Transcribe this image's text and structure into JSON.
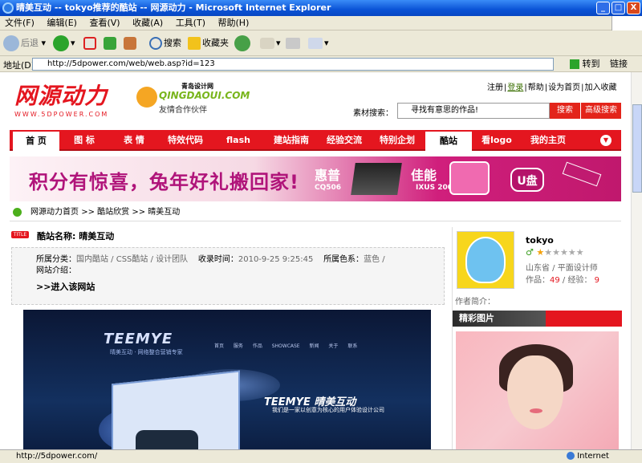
{
  "window": {
    "title": "晴美互动 -- tokyo推荐的酷站 -- 网源动力 - Microsoft Internet Explorer",
    "buttons": [
      "_",
      "□",
      "X"
    ]
  },
  "menubar": [
    "文件(F)",
    "编辑(E)",
    "查看(V)",
    "收藏(A)",
    "工具(T)",
    "帮助(H)"
  ],
  "toolbar": {
    "back": "后退",
    "search": "搜索",
    "favorites": "收藏夹"
  },
  "address": {
    "label": "地址(D)",
    "url": "http://5dpower.com/web/web.asp?id=123",
    "go": "转到",
    "links": "链接"
  },
  "site": {
    "logo_main": "网源动力",
    "logo_sub": "WWW.5DPOWER.COM",
    "partner": {
      "top": "青岛设计网",
      "name": "QINGDAOUI.COM",
      "label": "友情合作伙伴"
    },
    "top_links": [
      "注册",
      "登录",
      "帮助",
      "设为首页",
      "加入收藏"
    ],
    "search": {
      "label": "素材搜索：",
      "placeholder": "寻找有意思的作品!",
      "button": "搜索",
      "advanced": "高级搜索"
    },
    "nav": [
      "首  页",
      "图  标",
      "表  情",
      "特效代码",
      "flash",
      "建站指南",
      "经验交流",
      "特别企划",
      "酷站",
      "看logo",
      "我的主页"
    ],
    "banner": {
      "slogan": "积分有惊喜，兔年好礼搬回家!",
      "brand1": "惠普",
      "brand1_model": "CQ506",
      "brand2": "佳能",
      "brand2_model": "IXUS 200",
      "usb": "U盘"
    },
    "breadcrumb": [
      "网源动力首页",
      ">>",
      "酷站欣赏",
      ">>",
      "晴美互动"
    ]
  },
  "detail": {
    "name_label": "酷站名称:",
    "name": "晴美互动",
    "category_label": "所属分类：",
    "category": "国内酷站  / CSS酷站  / 设计团队",
    "date_label": "收录时间：",
    "date": "2010-9-25 9:25:45",
    "color_label": "所属色系：",
    "color": "蓝色  /",
    "intro_label": "网站介绍：",
    "enter": ">>进入该网站",
    "preview": {
      "logo": "TEEMYE",
      "subtitle": "晴美互动 · 网络整合营销专家",
      "logo2": "TEEMYE 晴美互动",
      "slogan2": "我们是一家以创意为核心的用户体验设计公司"
    }
  },
  "author": {
    "name": "tokyo",
    "gender_icon": "male-icon",
    "stars": 1,
    "max_stars": 6,
    "location": "山东省  / 平面设计师",
    "works_label": "作品：",
    "works": "49",
    "exp_label": "/ 经验：",
    "exp": "9",
    "bio_label": "作者简介：",
    "section_title": "精彩图片"
  },
  "status": {
    "text": "http://5dpower.com/",
    "zone": "Internet"
  },
  "colors": {
    "brand_red": "#e4161f",
    "xp_blue": "#0a53d6",
    "banner_pink": "#d01f7c"
  }
}
